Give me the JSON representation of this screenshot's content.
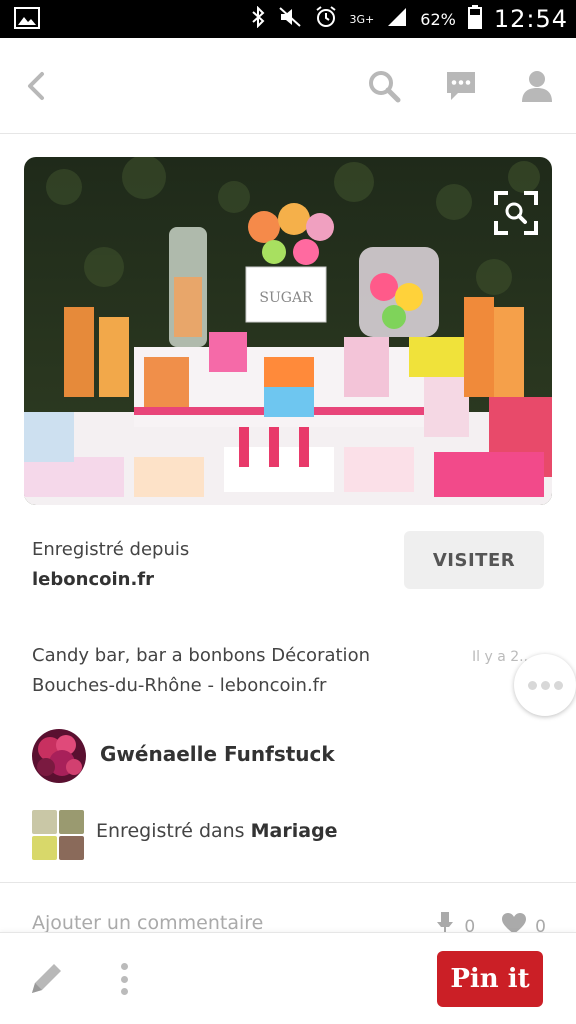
{
  "status_bar": {
    "network": "3G+",
    "battery_percent": "62%",
    "time": "12:54",
    "icons": [
      "gallery-icon",
      "bluetooth-icon",
      "mute-icon",
      "alarm-icon",
      "signal-icon",
      "battery-icon"
    ]
  },
  "header": {
    "icons": [
      "back-arrow-icon",
      "search-icon",
      "chat-icon",
      "profile-icon"
    ]
  },
  "pin": {
    "image_icon": "visual-search-icon",
    "image_label": "SUGAR",
    "saved_from_label": "Enregistré depuis",
    "source_domain": "leboncoin.fr",
    "visit_label": "VISITER",
    "description": "Candy bar, bar a bonbons Décoration Bouches-du-Rhône - leboncoin.fr",
    "time_ago": "Il y a 2...",
    "user_name": "Gwénaelle Funfstuck",
    "saved_in_label": "Enregistré dans",
    "board_name": "Mariage"
  },
  "comment": {
    "placeholder": "Ajouter un commentaire",
    "pin_count": "0",
    "like_count": "0"
  },
  "bottom_bar": {
    "pinit_label": "Pin it"
  },
  "colors": {
    "pinterest_red": "#cb1f26",
    "visit_button_bg": "#efefef"
  }
}
